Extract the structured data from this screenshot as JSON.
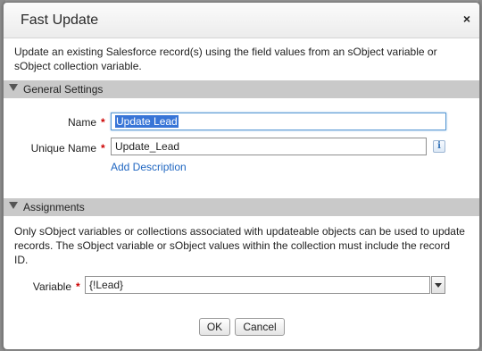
{
  "dialog": {
    "title": "Fast Update",
    "close_glyph": "×",
    "intro": "Update an existing Salesforce record(s) using the field values from an sObject variable or sObject collection variable."
  },
  "general_settings": {
    "header": "General Settings",
    "name_label": "Name",
    "name_value": "Update Lead",
    "unique_name_label": "Unique Name",
    "unique_name_value": "Update_Lead",
    "info_glyph": "i",
    "add_description": "Add Description",
    "required_glyph": "*"
  },
  "assignments": {
    "header": "Assignments",
    "description": "Only sObject variables or collections associated with updateable objects can be used to update records. The sObject variable or sObject values within the collection must include the record ID.",
    "variable_label": "Variable",
    "variable_value": "{!Lead}",
    "required_glyph": "*"
  },
  "footer": {
    "ok_label": "OK",
    "cancel_label": "Cancel"
  },
  "colors": {
    "section_header_bg": "#c9c9c9",
    "required": "#cc0000",
    "link": "#1f66c1",
    "selection": "#3875d7"
  }
}
